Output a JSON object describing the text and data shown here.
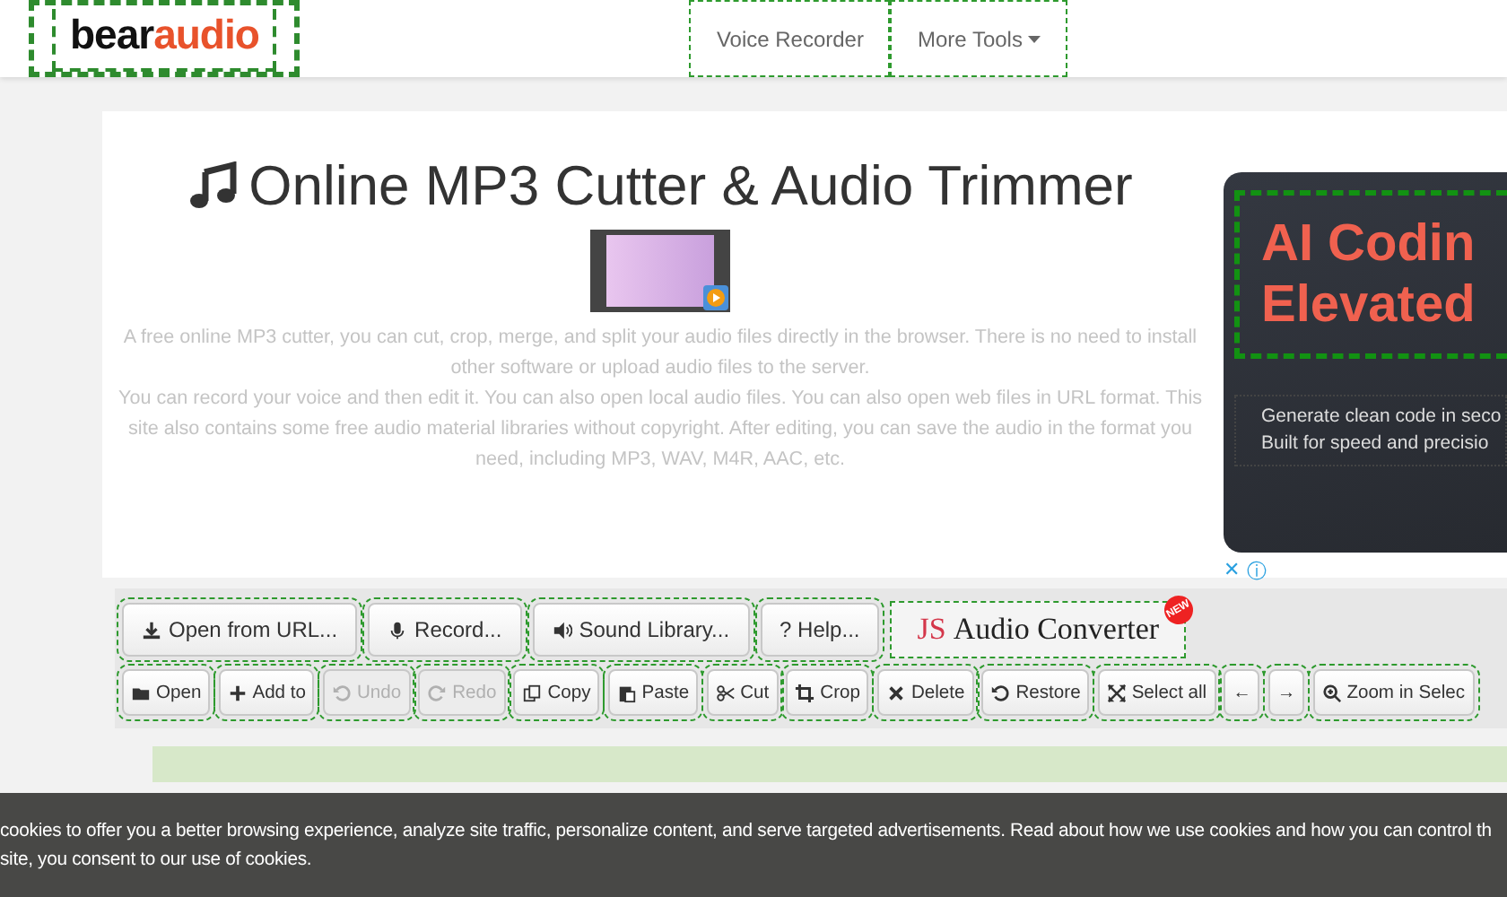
{
  "header": {
    "logo": [
      {
        "text": "bear",
        "color": "#111111"
      },
      {
        "text": "audio",
        "color": "#e8522b"
      }
    ],
    "nav": [
      {
        "label": "Voice Recorder",
        "kind": "link"
      },
      {
        "label": "More Tools",
        "kind": "dropdown"
      }
    ]
  },
  "hero": {
    "title": "Online MP3 Cutter & Audio Trimmer",
    "paragraphs": [
      "A free online MP3 cutter, you can cut, crop, merge, and split your audio files directly in the browser. There is no need to install other software or upload audio files to the server.",
      "You can record your voice and then edit it. You can also open local audio files. You can also open web files in URL format. This site also contains some free audio material libraries without copyright. After editing, you can save the audio in the format you need, including MP3, WAV, M4R, AAC, etc."
    ]
  },
  "ad": {
    "headline": [
      "AI Codin",
      "Elevated"
    ],
    "body": [
      "Generate clean code in seco",
      "Built for speed and precisio"
    ],
    "close": "✕",
    "info": "ⓘ"
  },
  "toolbar": {
    "actions": [
      {
        "label": "Open from URL...",
        "kind": "download"
      },
      {
        "label": "Record...",
        "kind": "mic"
      },
      {
        "label": "Sound Library...",
        "kind": "speaker"
      },
      {
        "label": "? Help...",
        "kind": "plain"
      }
    ],
    "promo": {
      "prefix": "JS",
      "name": "Audio Converter",
      "badge": "NEW"
    },
    "tools": [
      {
        "label": "Open",
        "kind": "folder",
        "disabled": false
      },
      {
        "label": "Add to",
        "kind": "plus",
        "disabled": false
      },
      {
        "label": "Undo",
        "kind": "undo",
        "disabled": true
      },
      {
        "label": "Redo",
        "kind": "redo",
        "disabled": true
      },
      {
        "label": "Copy",
        "kind": "copy",
        "disabled": false
      },
      {
        "label": "Paste",
        "kind": "paste",
        "disabled": false
      },
      {
        "label": "Cut",
        "kind": "scissors",
        "disabled": false
      },
      {
        "label": "Crop",
        "kind": "crop",
        "disabled": false
      },
      {
        "label": "Delete",
        "kind": "times",
        "disabled": false
      },
      {
        "label": "Restore",
        "kind": "undo",
        "disabled": false
      },
      {
        "label": "Select all",
        "kind": "expand",
        "disabled": false
      },
      {
        "label": "←",
        "kind": "plain",
        "disabled": false
      },
      {
        "label": "→",
        "kind": "plain",
        "disabled": false
      },
      {
        "label": "Zoom in Selec",
        "kind": "zoom",
        "disabled": false
      }
    ]
  },
  "cookie_banner": {
    "lines": [
      "cookies to offer you a better browsing experience, analyze site traffic, personalize content, and serve targeted advertisements. Read about how we use cookies and how you can control th",
      "site, you consent to our use of cookies."
    ]
  }
}
